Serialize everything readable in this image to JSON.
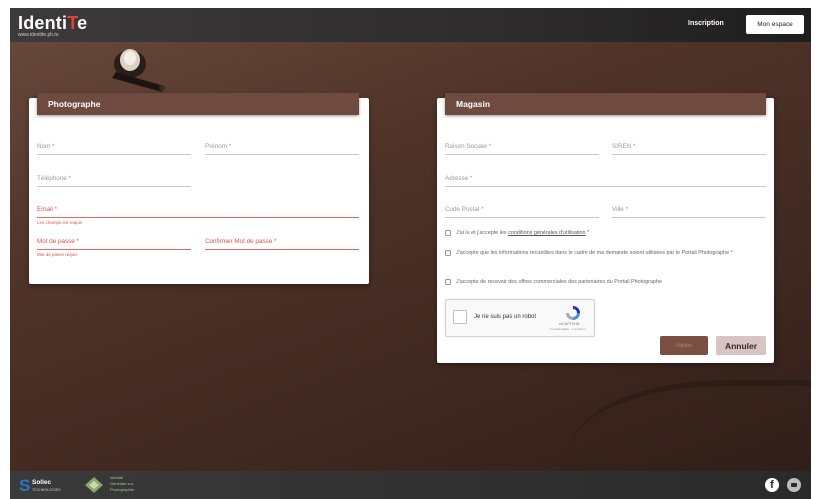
{
  "header": {
    "logo_prefix": "Identi",
    "logo_accent": "T",
    "logo_suffix": "e",
    "logo_url": "www.identite.ph.tu",
    "inscription_link": "Inscription",
    "my_space_button": "Mon espace"
  },
  "photographe": {
    "title": "Photographe",
    "fields": {
      "nom": "Nom *",
      "prenom": "Prénom *",
      "telephone": "Téléphone *",
      "email": "Email *",
      "email_error": "Les champs est requis",
      "password": "Mot de passe *",
      "password_error": "Mot de passe requis",
      "confirm_password": "Confirmer Mot de passe *"
    }
  },
  "magasin": {
    "title": "Magasin",
    "fields": {
      "raison_sociale": "Raison Sociale *",
      "siren": "SIREN *",
      "adresse": "Adresse *",
      "code_postal": "Code Postal *",
      "ville": "Ville *"
    },
    "checkboxes": {
      "cgu_prefix": "J'ai lu et j'accepte les ",
      "cgu_link": "conditions générales d'utilisation",
      "cgu_suffix": " *",
      "data_usage": "J'accepte que les informations recueillies dans le cadre de ma demande soient utilisées par le Portail Photographe *",
      "offers": "J'accepte de recevoir des offres commerciales des partenaires du Portail Photographe"
    },
    "recaptcha": {
      "label": "Je ne suis pas un robot",
      "brand": "reCAPTCHA",
      "links": "Confidentialité - Conditions"
    },
    "save_button": "Valider",
    "cancel_button": "Annuler"
  },
  "footer": {
    "company_name": "Sollec",
    "company_sub": "TECHNOLOGIES",
    "partner_line1": "Identité",
    "partner_line2": "Générale s.a.",
    "partner_line3": "Photographie"
  },
  "colors": {
    "header_brown": "#6e4a3f",
    "accent_red": "#e0452d",
    "error_red": "#d9534f",
    "cancel_bg": "#d8c4c0",
    "save_bg": "#7b4f41"
  },
  "icons": [
    "lamp-icon",
    "recaptcha-icon",
    "facebook-icon",
    "social-icon",
    "sollec-logo",
    "partner-logo"
  ]
}
